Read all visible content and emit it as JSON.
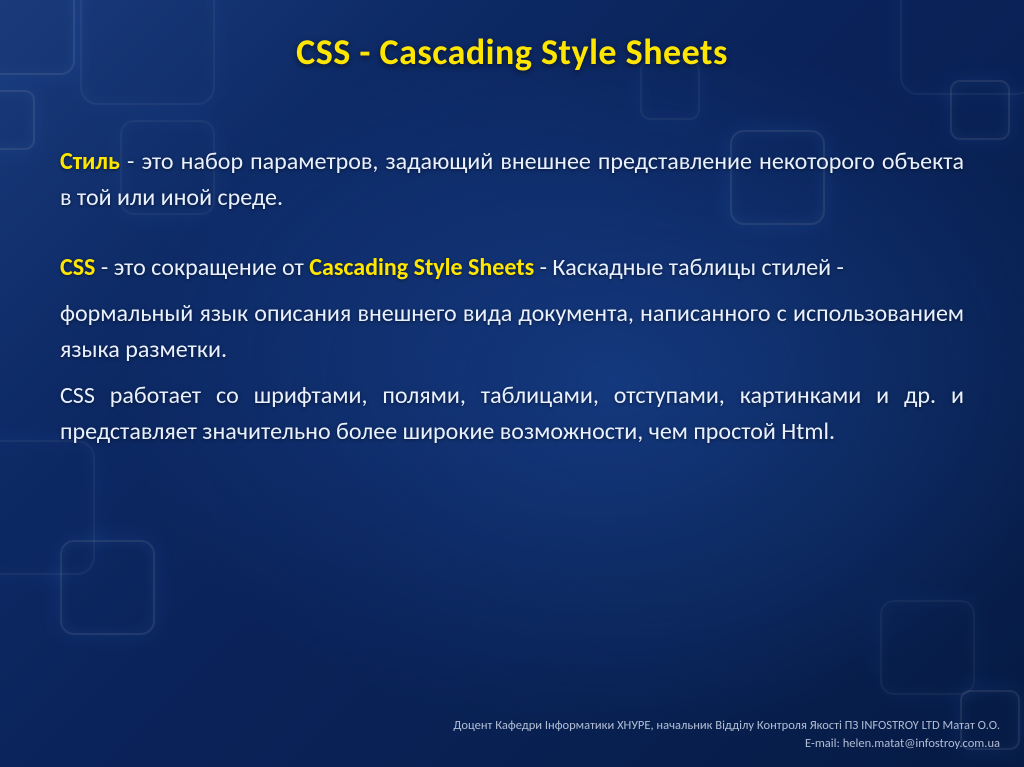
{
  "title": "CSS - Cascading Style Sheets",
  "p1": {
    "kw": "Стиль",
    "rest": " - это набор параметров, задающий внешнее представление некоторого объекта в той или иной среде."
  },
  "p2": {
    "kw1": "CSS",
    "mid": " - это сокращение от ",
    "kw2": "Cascading Style Sheets",
    "rest": " - Каскадные таблицы стилей -"
  },
  "p3": "формальный язык описания внешнего вида документа, написанного с использованием языка разметки.",
  "p4": "CSS работает со шрифтами, полями, таблицами, отступами, картинками и др. и представляет значительно более широкие возможности, чем простой Html.",
  "footer": {
    "line1": "Доцент Кафедри Інформатики ХНУРЕ, начальник Відділу Контроля Якості ПЗ INFOSTROY LTD Матат О.О.",
    "line2": "E-mail: helen.matat@infostroy.com.ua"
  }
}
